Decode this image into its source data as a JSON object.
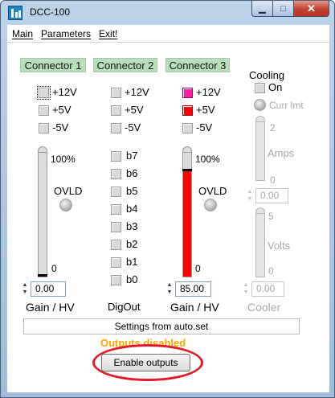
{
  "window": {
    "title": "DCC-100",
    "minimize_glyph": "▁",
    "maximize_glyph": "□",
    "close_glyph": "✕"
  },
  "menu": {
    "items": [
      {
        "label": "Main"
      },
      {
        "label": "Parameters"
      },
      {
        "label": "Exit!"
      }
    ]
  },
  "connector1": {
    "tab": "Connector 1",
    "supplies": [
      "+12V",
      "+5V",
      "-5V"
    ],
    "percent_max": "100%",
    "percent_min": "0",
    "ovld": "OVLD",
    "value": "0.00",
    "level_fraction": 0,
    "footer": "Gain / HV"
  },
  "connector2": {
    "tab": "Connector 2",
    "supplies": [
      "+12V",
      "+5V",
      "-5V"
    ],
    "bits": [
      "b7",
      "b6",
      "b5",
      "b4",
      "b3",
      "b2",
      "b1",
      "b0"
    ],
    "footer": "DigOut"
  },
  "connector3": {
    "tab": "Connector 3",
    "supplies": [
      "+12V",
      "+5V",
      "-5V"
    ],
    "supply_colors": [
      "#ff1fa0",
      "#ff0000",
      "#d9d9d9"
    ],
    "percent_max": "100%",
    "percent_min": "0",
    "ovld": "OVLD",
    "value": "85.00",
    "level_fraction": 0.85,
    "fill_color": "#ff0000",
    "footer": "Gain / HV"
  },
  "cooling": {
    "title": "Cooling",
    "on_label": "On",
    "curr_limit": "Curr lmt",
    "amps_max": "2",
    "amps_label": "Amps",
    "amps_min": "0",
    "amps_value": "0.00",
    "volts_max": "5",
    "volts_label": "Volts",
    "volts_min": "0",
    "volts_value": "0.00",
    "footer": "Cooler"
  },
  "settings_source": "Settings from auto.set",
  "status": "Outputs disabled",
  "enable_button": "Enable outputs",
  "colors": {
    "tab_green": "#b7dfb9",
    "status_orange": "#ffa500",
    "annotation_red": "#e21b2b"
  }
}
